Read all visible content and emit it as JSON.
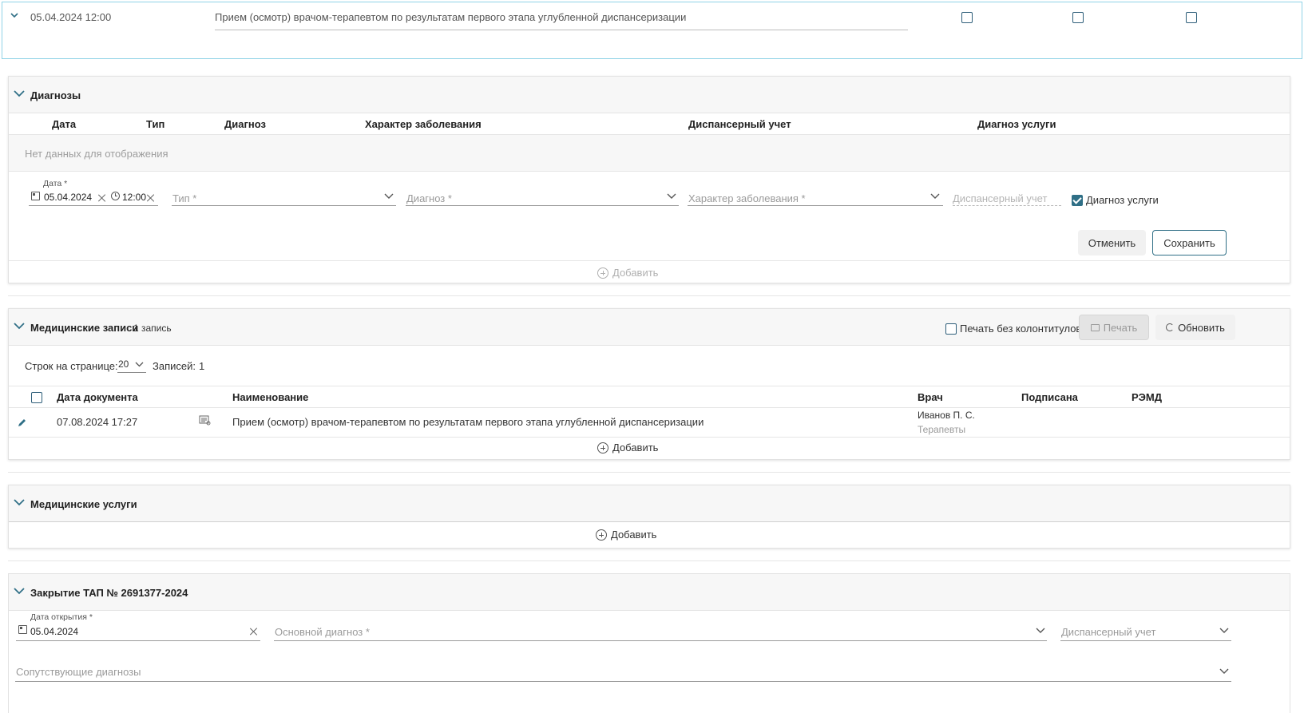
{
  "top_row": {
    "datetime": "05.04.2024 12:00",
    "name": "Прием (осмотр) врачом-терапевтом по результатам первого этапа углубленной диспансеризации"
  },
  "diagnoses": {
    "title": "Диагнозы",
    "columns": [
      "Дата",
      "Тип",
      "Диагноз",
      "Характер заболевания",
      "Диспансерный учет",
      "Диагноз услуги"
    ],
    "empty_text": "Нет данных для отображения",
    "form": {
      "date_label": "Дата *",
      "date_value": "05.04.2024",
      "time_value": "12:00",
      "type_placeholder": "Тип *",
      "diagnosis_placeholder": "Диагноз *",
      "character_placeholder": "Характер заболевания *",
      "dispensary_placeholder": "Диспансерный учет",
      "service_diagnosis_label": "Диагноз услуги",
      "service_diagnosis_checked": true,
      "cancel_label": "Отменить",
      "save_label": "Сохранить"
    },
    "add_label": "Добавить"
  },
  "medical_records": {
    "title": "Медицинские записи",
    "count_text": "1 запись",
    "print_no_headers_label": "Печать без колонтитулов",
    "print_label": "Печать",
    "refresh_label": "Обновить",
    "rows_per_page_label": "Строк на странице:",
    "rows_per_page_value": "20",
    "records_label": "Записей:",
    "records_value": "1",
    "columns": [
      "Дата документа",
      "Наименование",
      "Врач",
      "Подписана",
      "РЭМД"
    ],
    "rows": [
      {
        "date": "07.08.2024 17:27",
        "name": "Прием (осмотр) врачом-терапевтом по результатам первого этапа углубленной диспансеризации",
        "doctor": "Иванов П. С.",
        "doctor_role": "Терапевты",
        "signed": "",
        "remd": ""
      }
    ],
    "add_label": "Добавить"
  },
  "medical_services": {
    "title": "Медицинские услуги",
    "add_label": "Добавить"
  },
  "closing": {
    "title": "Закрытие ТАП № 2691377-2024",
    "open_date_label": "Дата открытия *",
    "open_date_value": "05.04.2024",
    "main_diagnosis_placeholder": "Основной диагноз *",
    "dispensary_placeholder": "Диспансерный учет",
    "concomitant_placeholder": "Сопутствующие диагнозы"
  },
  "colors": {
    "accent": "#2f6f86",
    "highlight_border": "#8fd3e6"
  }
}
